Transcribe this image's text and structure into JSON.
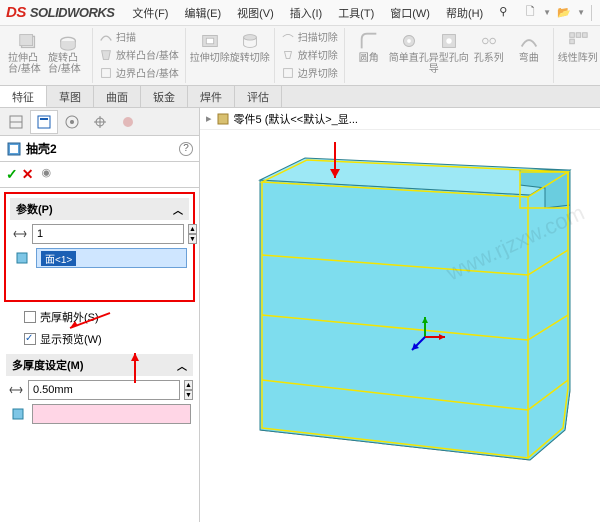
{
  "app_name": "SOLIDWORKS",
  "menus": {
    "file": "文件(F)",
    "edit": "编辑(E)",
    "view": "视图(V)",
    "insert": "插入(I)",
    "tools": "工具(T)",
    "window": "窗口(W)",
    "help": "帮助(H)"
  },
  "ribbon": {
    "extrude_boss": "拉伸凸台/基体",
    "revolve_boss": "旋转凸台/基体",
    "swept": "扫描",
    "loft": "放样凸台/基体",
    "boundary": "边界凸台/基体",
    "extrude_cut": "拉伸切除",
    "revolve_cut": "旋转切除",
    "swept_cut": "扫描切除",
    "loft_cut": "放样切除",
    "boundary_cut": "边界切除",
    "fillet": "圆角",
    "hole_simple": "简单直孔",
    "hole_draft": "异型孔向导",
    "hole_series": "孔系列",
    "bend": "弯曲",
    "linear_pattern": "线性阵列"
  },
  "tabs": {
    "feature": "特征",
    "sketch": "草图",
    "surface": "曲面",
    "sheetmetal": "钣金",
    "weldment": "焊件",
    "evaluate": "评估"
  },
  "feature": {
    "name": "抽壳2",
    "params_label": "参数(P)",
    "thickness_value": "1",
    "selected_face": "面<1>",
    "shell_outward": "壳厚朝外(S)",
    "show_preview": "显示预览(W)",
    "multi_thickness": "多厚度设定(M)",
    "multi_value": "0.50mm"
  },
  "viewport": {
    "part_label": "零件5 (默认<<默认>_显..."
  },
  "watermark": "www.rjzxw.com"
}
